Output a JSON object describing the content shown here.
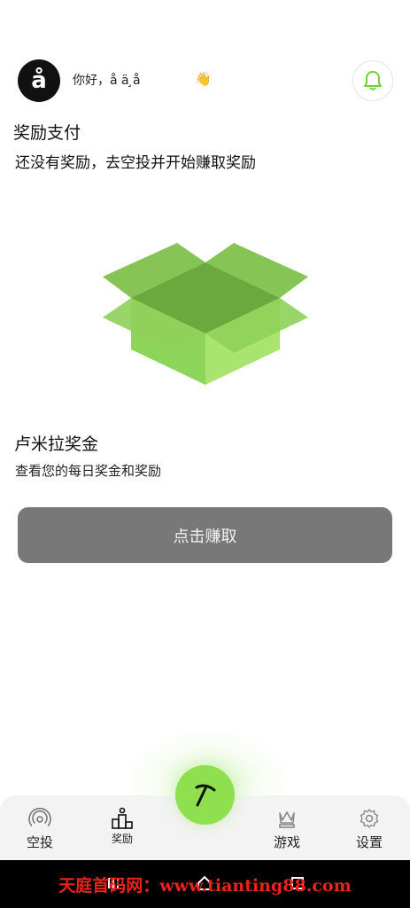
{
  "header": {
    "avatar_letter": "å",
    "greeting": "你好，å ä ̧å",
    "wave_emoji": "👋"
  },
  "rewards": {
    "title": "奖励支付",
    "empty_message": "还没有奖励，去空投并开始赚取奖励"
  },
  "bonus": {
    "title": "卢米拉奖金",
    "description": "查看您的每日奖金和奖励"
  },
  "earn_button": {
    "label": "点击赚取"
  },
  "tabbar": {
    "tabs": [
      {
        "label": "空投",
        "icon": "airdrop-icon"
      },
      {
        "label": "奖励",
        "icon": "podium-icon"
      },
      {
        "label": "游戏",
        "icon": "chess-queen-icon"
      },
      {
        "label": "设置",
        "icon": "gear-icon"
      }
    ],
    "center": {
      "icon": "pickaxe-icon"
    }
  },
  "watermark": "天庭首码网：www.tianting88.com",
  "colors": {
    "accent_green": "#8ee04e",
    "button_gray": "#787878",
    "box_green": "#a5e26a",
    "watermark_red": "#e8241b"
  }
}
